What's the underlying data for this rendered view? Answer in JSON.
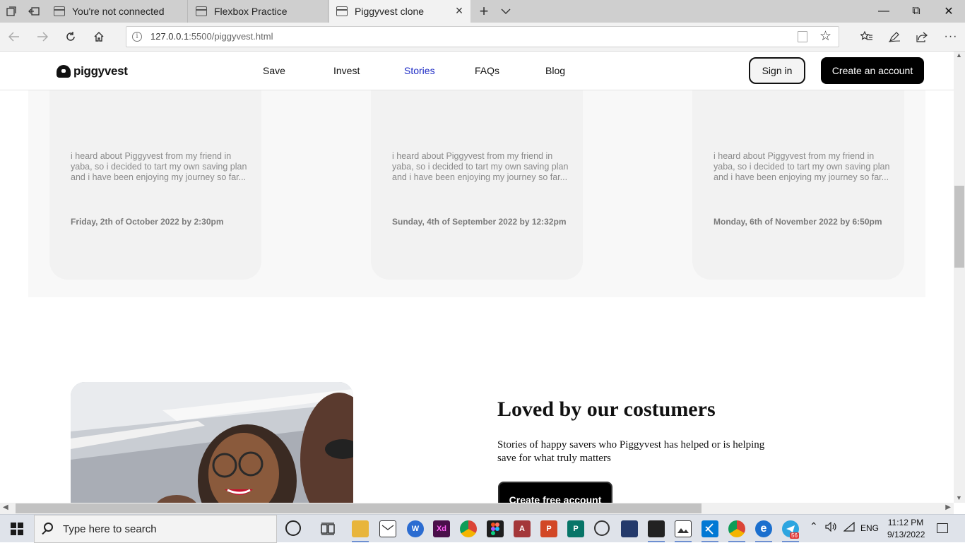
{
  "browser": {
    "tabs": [
      {
        "title": "You're not connected",
        "active": false
      },
      {
        "title": "Flexbox Practice",
        "active": false
      },
      {
        "title": "Piggyvest clone",
        "active": true
      }
    ],
    "new_tab": "+",
    "tab_list": "⌄",
    "window": {
      "minimize": "—",
      "restore": "⧉",
      "close": "✕"
    },
    "url_host": "127.0.0.1",
    "url_rest": ":5500/piggyvest.html",
    "info_icon": "i"
  },
  "site": {
    "brand": "piggyvest",
    "nav": [
      {
        "label": "Save",
        "active": false
      },
      {
        "label": "Invest",
        "active": false
      },
      {
        "label": "Stories",
        "active": true
      },
      {
        "label": "FAQs",
        "active": false
      },
      {
        "label": "Blog",
        "active": false
      }
    ],
    "sign_in": "Sign in",
    "create_account": "Create an account",
    "accent_color": "#1d2bc5"
  },
  "stories": [
    {
      "quote": "i heard about Piggyvest from my friend in yaba, so i decided to tart my own saving plan and i have been enjoying my journey so far...",
      "date": "Friday, 2th of October 2022 by 2:30pm"
    },
    {
      "quote": "i heard about Piggyvest from my friend in yaba, so i decided to tart my own saving plan and i have been enjoying my journey so far...",
      "date": "Sunday, 4th of September 2022 by 12:32pm"
    },
    {
      "quote": "i heard about Piggyvest from my friend in yaba, so i decided to tart my own saving plan and i have been enjoying my journey so far...",
      "date": "Monday, 6th of November 2022 by 6:50pm"
    }
  ],
  "loved": {
    "title": "Loved by our costumers",
    "subtitle": "Stories of happy savers who Piggyvest has helped or is helping save for what truly matters",
    "button": "Create free account"
  },
  "taskbar": {
    "search_placeholder": "Type here to search",
    "apps": [
      "Cortana",
      "Task View",
      "File Explorer",
      "Mail",
      "Word",
      "Adobe XD",
      "Chrome",
      "Figma",
      "Access",
      "PowerPoint",
      "Publisher",
      "Camera",
      "Media",
      "Movies",
      "Photos",
      "VS Code",
      "Chrome Profile",
      "Edge",
      "Telegram"
    ],
    "telegram_badge": "56",
    "language": "ENG",
    "time": "11:12 PM",
    "date": "9/13/2022"
  }
}
